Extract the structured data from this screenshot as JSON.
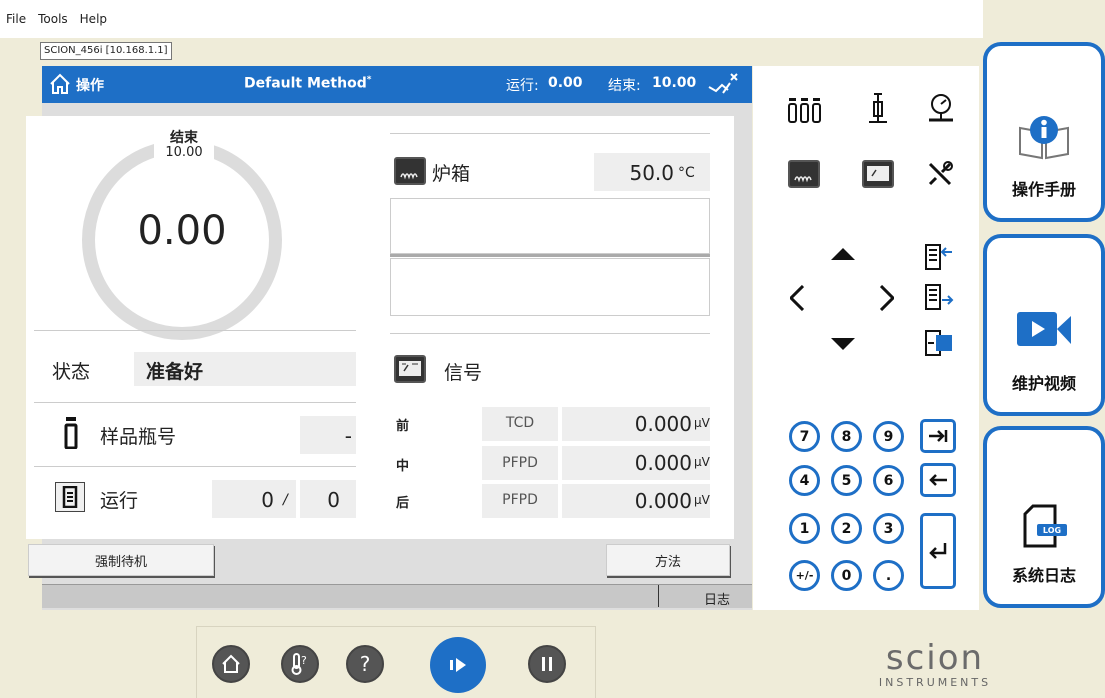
{
  "menu": {
    "file": "File",
    "tools": "Tools",
    "help": "Help"
  },
  "connection": "SCION_456i [10.168.1.1]",
  "header": {
    "title": "操作",
    "method": "Default Method",
    "method_mark": "*",
    "run_label": "运行:",
    "run_value": "0.00",
    "end_label": "结束:",
    "end_value": "10.00"
  },
  "gauge": {
    "end_label": "结束",
    "end_value": "10.00",
    "current": "0.00"
  },
  "status": {
    "label": "状态",
    "value": "准备好"
  },
  "vial": {
    "label": "样品瓶号",
    "value": "-"
  },
  "run": {
    "label": "运行",
    "current": "0",
    "sep": "/",
    "total": "0"
  },
  "oven": {
    "label": "炉箱",
    "value": "50.0",
    "unit": "°C"
  },
  "signal": {
    "label": "信号",
    "rows": [
      {
        "pos": "前",
        "detector": "TCD",
        "value": "0.000",
        "unit": "µV"
      },
      {
        "pos": "中",
        "detector": "PFPD",
        "value": "0.000",
        "unit": "µV"
      },
      {
        "pos": "后",
        "detector": "PFPD",
        "value": "0.000",
        "unit": "µV"
      }
    ]
  },
  "buttons": {
    "standby": "强制待机",
    "method": "方法",
    "log": "日志"
  },
  "keypad": [
    "7",
    "8",
    "9",
    "4",
    "5",
    "6",
    "1",
    "2",
    "3",
    "+/-",
    "0",
    "."
  ],
  "side": {
    "manual": "操作手册",
    "video": "维护视频",
    "syslog": "系统日志",
    "log_badge": "LOG"
  },
  "brand": {
    "name": "scion",
    "sub": "INSTRUMENTS"
  },
  "colors": {
    "accent": "#1e6fc6",
    "background": "#efecd9"
  }
}
